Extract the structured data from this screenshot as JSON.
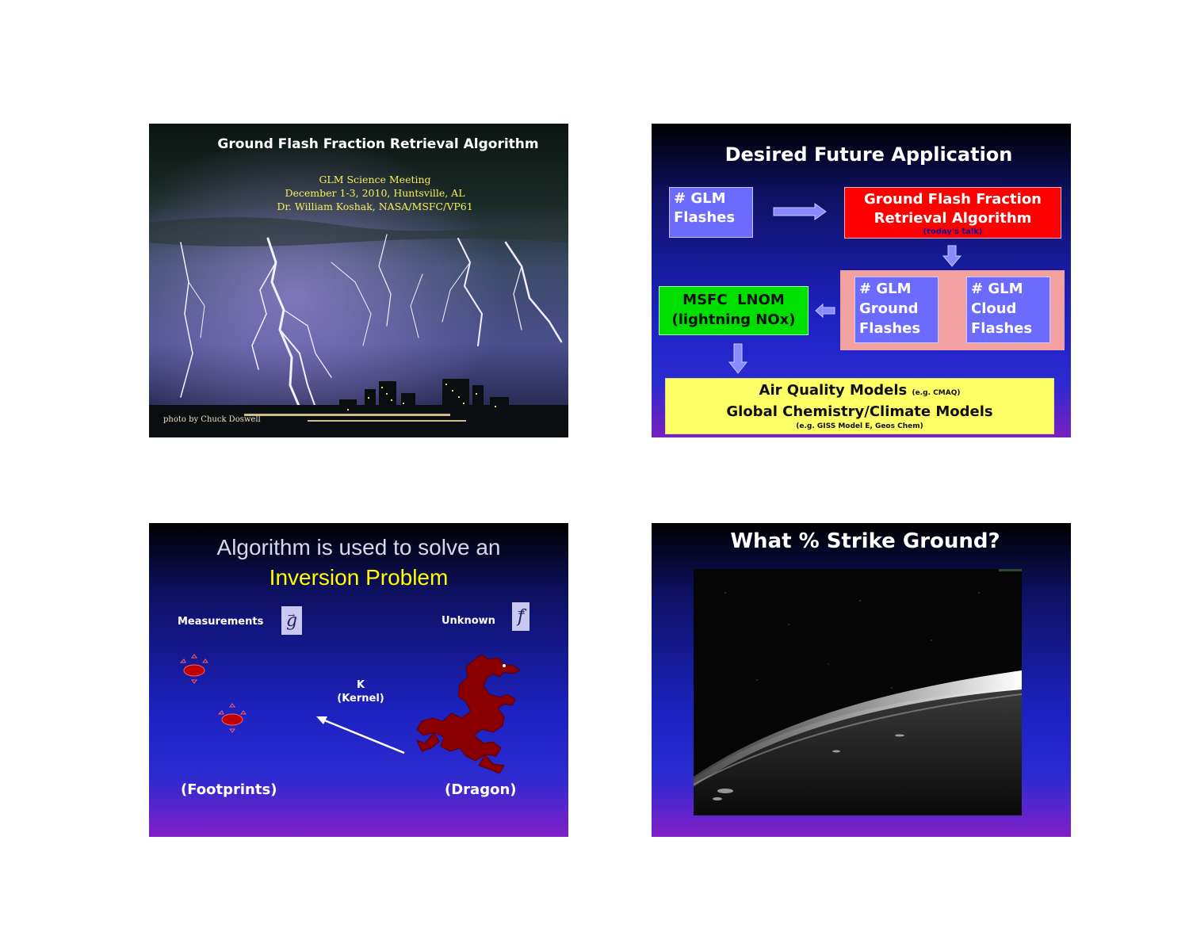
{
  "slide1": {
    "title": "Ground Flash Fraction Retrieval Algorithm",
    "meeting": "GLM Science Meeting",
    "dates": "December 1-3, 2010, Huntsville, AL",
    "author": "Dr. William Koshak, NASA/MSFC/VP61",
    "credit": "photo by Chuck Doswell"
  },
  "slide2": {
    "title": "Desired Future Application",
    "glm_flashes": [
      "# GLM",
      "Flashes"
    ],
    "algorithm": [
      "Ground Flash Fraction",
      "Retrieval Algorithm"
    ],
    "algorithm_note": "(today's talk)",
    "ground_flashes": [
      "# GLM",
      "Ground",
      "Flashes"
    ],
    "cloud_flashes": [
      "# GLM",
      "Cloud",
      "Flashes"
    ],
    "lnom": [
      "MSFC  LNOM",
      "(lightning NOx)"
    ],
    "models_line1": "Air Quality Models",
    "models_line1_note": "(e.g. CMAQ)",
    "models_line2": "Global Chemistry/Climate Models",
    "models_line3": "(e.g. GISS Model E, Geos Chem)",
    "colors": {
      "glm_box": "#6b6bff",
      "algorithm_box": "#ff0000",
      "pink_panel": "#f2a0a0",
      "lnom_box": "#00e000",
      "models_box": "#ffff66"
    }
  },
  "slide3": {
    "title_line1": "Algorithm is used to solve an",
    "title_line2": "Inversion Problem",
    "measurements": "Measurements",
    "measurements_symbol": "g",
    "unknown": "Unknown",
    "unknown_symbol": "f",
    "kernel_k": "K",
    "kernel_label": "(Kernel)",
    "footprints": "(Footprints)",
    "dragon": "(Dragon)"
  },
  "slide4": {
    "title": "What % Strike Ground?"
  }
}
